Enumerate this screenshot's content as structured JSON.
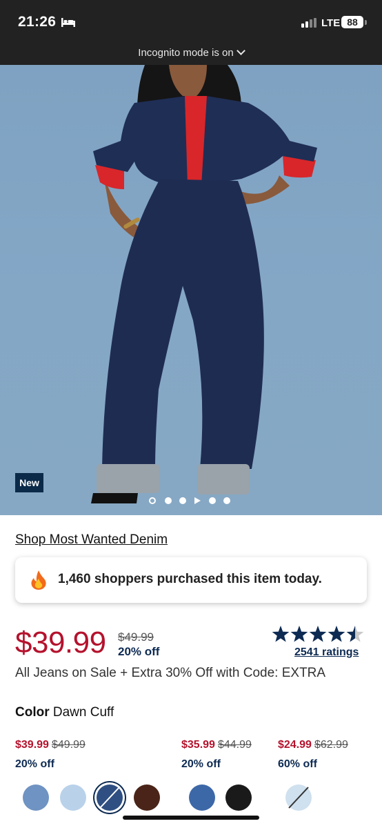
{
  "status_bar": {
    "time": "21:26",
    "network": "LTE",
    "battery": "88"
  },
  "browser": {
    "incognito_label": "Incognito mode is on"
  },
  "hero": {
    "badge": "New",
    "carousel_count": 6,
    "carousel_active_index": 0
  },
  "product": {
    "collection_link": "Shop Most Wanted Denim",
    "social_proof": "1,460 shoppers purchased this item today.",
    "price": "$39.99",
    "original_price": "$49.99",
    "discount": "20% off",
    "rating_stars": 4.5,
    "ratings_count": "2541 ratings",
    "promo_text": "All Jeans on Sale + Extra 30% Off with Code: EXTRA",
    "color_label": "Color",
    "color_value": "Dawn Cuff"
  },
  "variant_prices": [
    {
      "now": "$39.99",
      "was": "$49.99",
      "off": "20% off"
    },
    {
      "now": "$35.99",
      "was": "$44.99",
      "off": "20% off"
    },
    {
      "now": "$24.99",
      "was": "$62.99",
      "off": "60% off"
    }
  ],
  "swatches": [
    {
      "name": "medium-wash",
      "color": "#6f93c2",
      "selected": false,
      "unavailable": false
    },
    {
      "name": "light-wash",
      "color": "#b9d2ea",
      "selected": false,
      "unavailable": false
    },
    {
      "name": "dawn-cuff",
      "color": "#2f4f82",
      "selected": true,
      "unavailable": true
    },
    {
      "name": "brown",
      "color": "#4a2418",
      "selected": false,
      "unavailable": false
    },
    {
      "name": "mid-blue",
      "color": "#3d68a8",
      "selected": false,
      "unavailable": false
    },
    {
      "name": "black",
      "color": "#1a1a1a",
      "selected": false,
      "unavailable": false
    },
    {
      "name": "bleached",
      "color": "#cfe0ee",
      "selected": false,
      "unavailable": true
    }
  ],
  "colors": {
    "sale_red": "#b5122d",
    "navy": "#0d2a52",
    "status_bar_bg": "#222222"
  }
}
